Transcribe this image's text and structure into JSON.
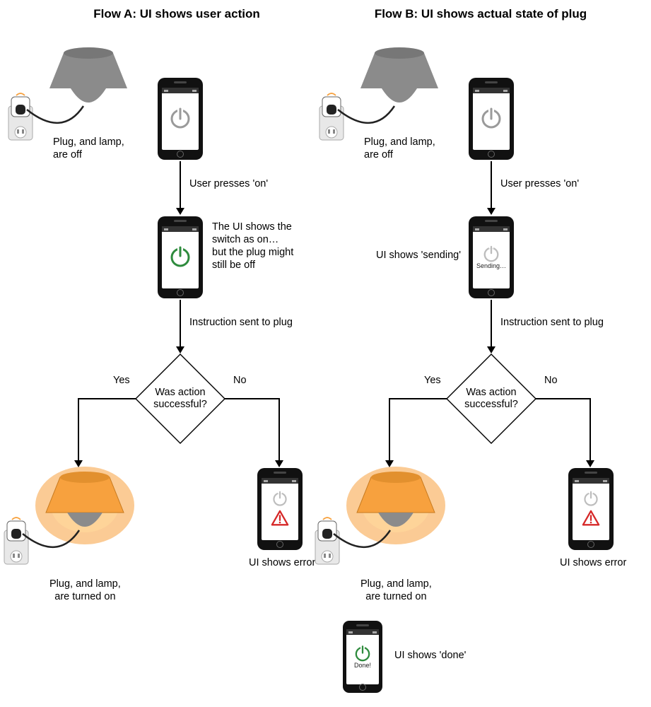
{
  "flowA": {
    "title": "Flow A: UI shows user action",
    "step1_caption": "Plug, and lamp,\nare off",
    "edge_user_presses": "User presses 'on'",
    "step2_caption": "The UI shows the\nswitch as on…\nbut the plug might\nstill be off",
    "edge_instruction": "Instruction sent to plug",
    "decision": "Was action\nsuccessful?",
    "decision_yes": "Yes",
    "decision_no": "No",
    "yes_caption": "Plug, and lamp,\nare turned on",
    "no_caption": "UI shows error"
  },
  "flowB": {
    "title": "Flow B: UI shows actual state of plug",
    "step1_caption": "Plug, and lamp,\nare off",
    "edge_user_presses": "User presses 'on'",
    "step2_caption": "UI shows 'sending'",
    "step2_screen_text": "Sending…",
    "edge_instruction": "Instruction sent to plug",
    "decision": "Was action\nsuccessful?",
    "decision_yes": "Yes",
    "decision_no": "No",
    "yes_caption": "Plug, and lamp,\nare turned on",
    "no_caption": "UI shows error",
    "done_caption": "UI shows 'done'",
    "done_screen_text": "Done!"
  },
  "colors": {
    "power_off": "#9a9a9a",
    "power_on": "#2e8b3d",
    "lamp_glow": "#f7a13e",
    "error": "#d62828"
  }
}
